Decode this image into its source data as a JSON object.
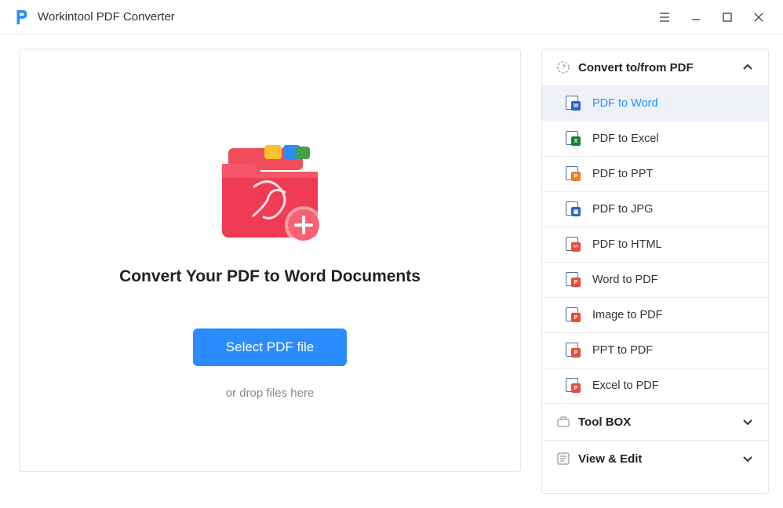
{
  "app": {
    "title": "Workintool PDF Converter"
  },
  "main": {
    "heading": "Convert Your PDF to Word Documents",
    "select_button": "Select PDF file",
    "drop_hint": "or drop files here"
  },
  "sidebar": {
    "sections": [
      {
        "title": "Convert to/from PDF",
        "expanded": true,
        "icon": "convert-icon",
        "items": [
          {
            "label": "PDF to Word",
            "badge": "W",
            "badge_color": "#2a62c9",
            "active": true
          },
          {
            "label": "PDF to Excel",
            "badge": "X",
            "badge_color": "#1e7e34",
            "active": false
          },
          {
            "label": "PDF to PPT",
            "badge": "P",
            "badge_color": "#e67e22",
            "active": false
          },
          {
            "label": "PDF to JPG",
            "badge": "▣",
            "badge_color": "#2a62c9",
            "active": false
          },
          {
            "label": "PDF to HTML",
            "badge": "</>",
            "badge_color": "#e74c3c",
            "active": false
          },
          {
            "label": "Word to PDF",
            "badge": "P",
            "badge_color": "#e74c3c",
            "active": false
          },
          {
            "label": "Image to PDF",
            "badge": "P",
            "badge_color": "#e74c3c",
            "active": false
          },
          {
            "label": "PPT to PDF",
            "badge": "P",
            "badge_color": "#e74c3c",
            "active": false
          },
          {
            "label": "Excel to PDF",
            "badge": "P",
            "badge_color": "#e74c3c",
            "active": false
          }
        ]
      },
      {
        "title": "Tool BOX",
        "expanded": false,
        "icon": "toolbox-icon"
      },
      {
        "title": "View & Edit",
        "expanded": false,
        "icon": "edit-icon"
      }
    ]
  }
}
